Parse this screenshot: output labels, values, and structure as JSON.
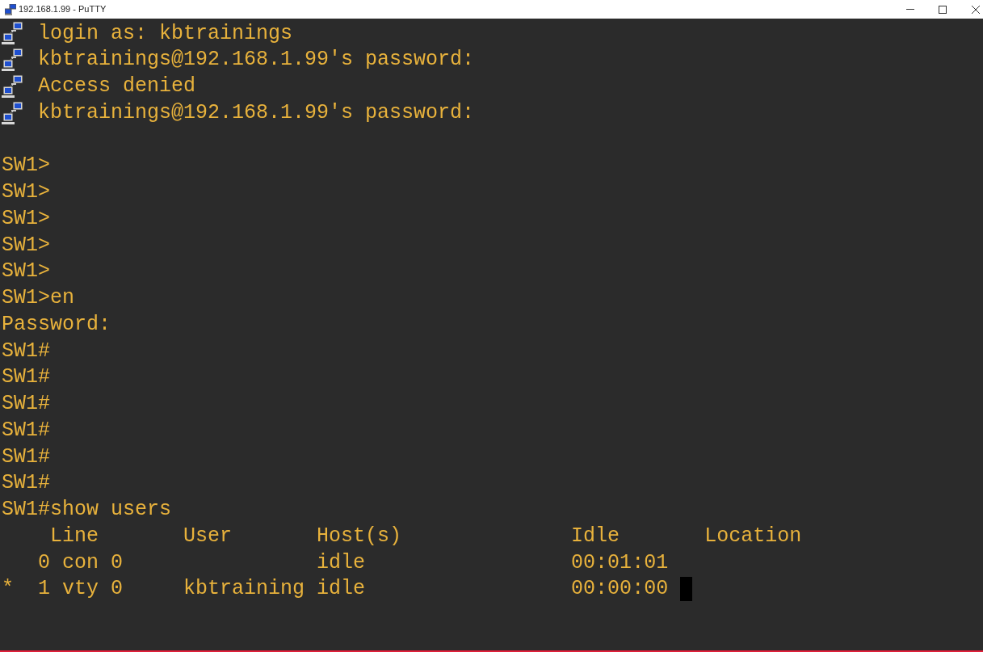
{
  "window": {
    "title": "192.168.1.99 - PuTTY"
  },
  "terminal": {
    "cursor": true,
    "lines": [
      {
        "kind": "prompt",
        "text": "login as: kbtrainings"
      },
      {
        "kind": "prompt",
        "text": "kbtrainings@192.168.1.99's password:"
      },
      {
        "kind": "prompt",
        "text": "Access denied"
      },
      {
        "kind": "prompt",
        "text": "kbtrainings@192.168.1.99's password:"
      },
      {
        "kind": "blank"
      },
      {
        "kind": "output",
        "text": "SW1>"
      },
      {
        "kind": "output",
        "text": "SW1>"
      },
      {
        "kind": "output",
        "text": "SW1>"
      },
      {
        "kind": "output",
        "text": "SW1>"
      },
      {
        "kind": "output",
        "text": "SW1>"
      },
      {
        "kind": "output",
        "text": "SW1>en"
      },
      {
        "kind": "output",
        "text": "Password:"
      },
      {
        "kind": "output",
        "text": "SW1#"
      },
      {
        "kind": "output",
        "text": "SW1#"
      },
      {
        "kind": "output",
        "text": "SW1#"
      },
      {
        "kind": "output",
        "text": "SW1#"
      },
      {
        "kind": "output",
        "text": "SW1#"
      },
      {
        "kind": "output",
        "text": "SW1#"
      },
      {
        "kind": "output",
        "text": "SW1#show users"
      },
      {
        "kind": "output",
        "text": "    Line       User       Host(s)              Idle       Location"
      },
      {
        "kind": "output",
        "text": "   0 con 0                idle                 00:01:01"
      },
      {
        "kind": "output",
        "text": "*  1 vty 0     kbtraining idle                 00:00:00"
      }
    ]
  }
}
